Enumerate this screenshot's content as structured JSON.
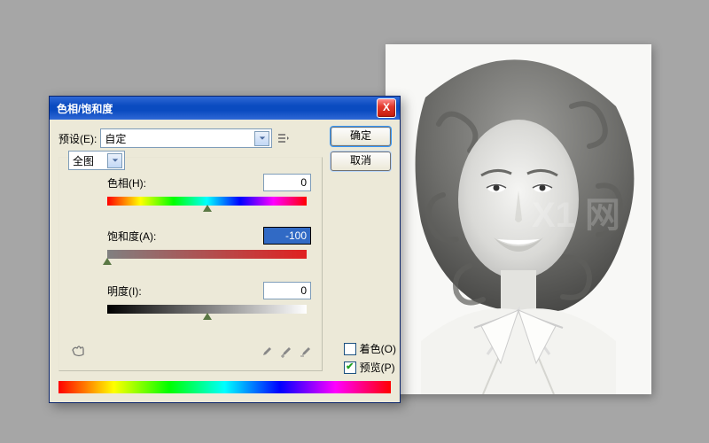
{
  "dialog": {
    "title": "色相/饱和度",
    "close": "X",
    "preset_label": "预设(E):",
    "preset_value": "自定",
    "scope_value": "全图",
    "ok_label": "确定",
    "cancel_label": "取消",
    "hue_label": "色相(H):",
    "hue_value": "0",
    "sat_label": "饱和度(A):",
    "sat_value": "-100",
    "lit_label": "明度(I):",
    "lit_value": "0",
    "colorize_label": "着色(O)",
    "preview_label": "预览(P)",
    "colorize_checked": false,
    "preview_checked": true
  },
  "sliders": {
    "hue_percent": 50,
    "sat_percent": 0,
    "lit_percent": 50
  },
  "watermark": "X1 网"
}
